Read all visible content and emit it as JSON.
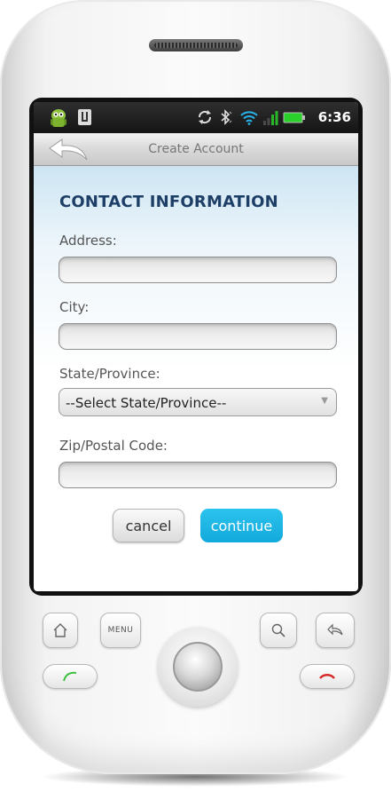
{
  "status_bar": {
    "time": "6:36",
    "icons": [
      "android-icon",
      "usb-icon",
      "sync-icon",
      "bluetooth-icon",
      "wifi-icon",
      "signal-icon",
      "battery-icon"
    ]
  },
  "title_bar": {
    "title": "Create Account",
    "back_icon": "back-arrow-icon"
  },
  "form": {
    "heading": "CONTACT INFORMATION",
    "address_label": "Address:",
    "address_value": "",
    "city_label": "City:",
    "city_value": "",
    "state_label": "State/Province:",
    "state_selected": "--Select State/Province--",
    "zip_label": "Zip/Postal Code:",
    "zip_value": ""
  },
  "buttons": {
    "cancel": "cancel",
    "continue": "continue"
  },
  "hardware_keys": {
    "home_icon": "home-icon",
    "menu": "MENU",
    "search_icon": "search-icon",
    "back_icon": "back-icon",
    "call_icon": "call-icon",
    "end_call_icon": "end-call-icon",
    "trackball": "trackball"
  },
  "colors": {
    "heading": "#1d3e66",
    "continue_button": "#1ab3e4",
    "call_green": "#3cbf3c",
    "end_call_red": "#d62a2a"
  }
}
